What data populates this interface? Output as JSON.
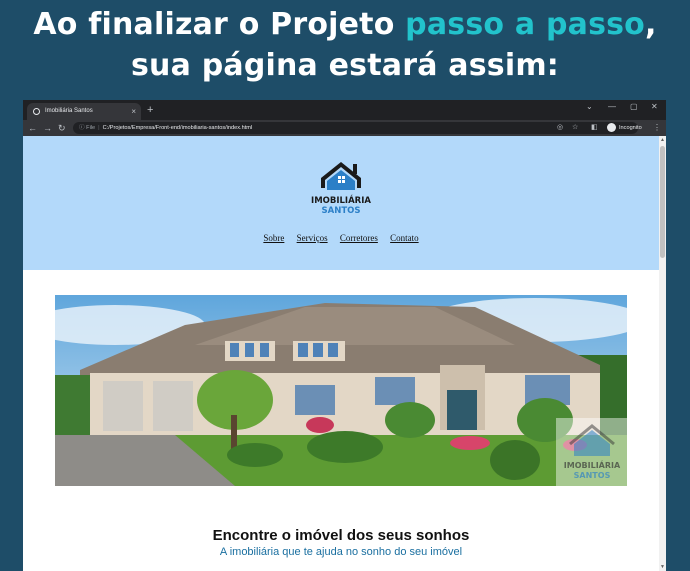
{
  "headline": {
    "line1_before": "Ao finalizar o Projeto ",
    "line1_highlight": "passo a passo",
    "line1_after": ",",
    "line2": "sua página estará assim:"
  },
  "browser": {
    "tab_title": "Imobiliária Santos",
    "tab_close": "×",
    "new_tab": "+",
    "window_controls": {
      "minimize": "—",
      "restore": "▢",
      "close": "✕",
      "tab_search": "⌄"
    },
    "url_info": "ⓘ File",
    "url": "C:/Projetos/Empresa/Front-end/imobiliaria-santos/index.html",
    "incognito_label": "Incognito"
  },
  "site": {
    "logo_text_line1": "IMOBILIÁRIA",
    "logo_text_line2": "SANTOS",
    "nav": [
      "Sobre",
      "Serviços",
      "Corretores",
      "Contato"
    ],
    "hero_title": "Encontre o imóvel dos seus sonhos",
    "hero_subtitle": "A imobiliária que te ajuda no sonho do seu imóvel"
  },
  "colors": {
    "background": "#1e4d68",
    "headline_highlight": "#22c3cc",
    "header_bg": "#b3d9fa",
    "logo_blue": "#2b7fc7",
    "subtitle": "#1a6fa0"
  }
}
